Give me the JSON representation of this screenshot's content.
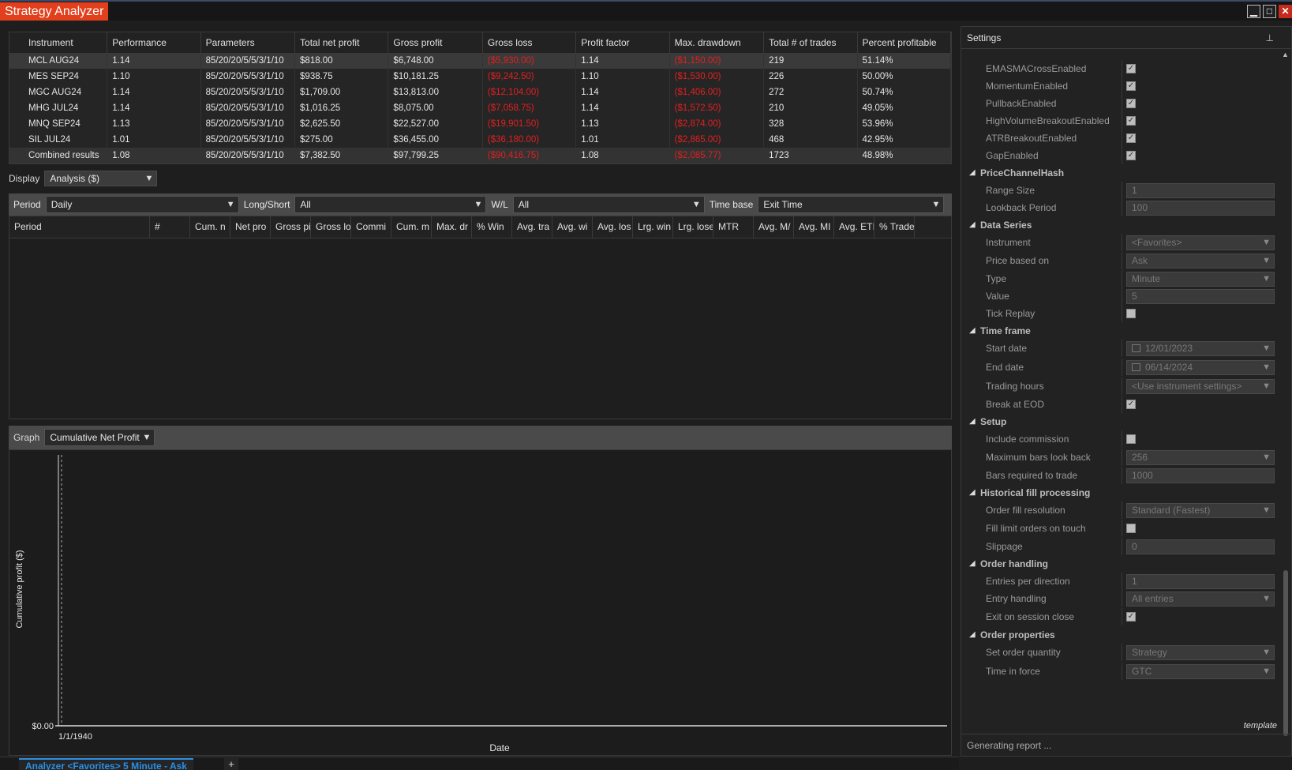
{
  "window": {
    "title": "Strategy Analyzer",
    "controls": {
      "minimize": "▁",
      "maximize": "□",
      "close": "✕"
    }
  },
  "results": {
    "columns": [
      "Instrument",
      "Performance",
      "Parameters",
      "Total net profit",
      "Gross profit",
      "Gross loss",
      "Profit factor",
      "Max. drawdown",
      "Total # of trades",
      "Percent profitable"
    ],
    "rows": [
      [
        "MCL AUG24",
        "1.14",
        "85/20/20/5/5/3/1/10",
        "$818.00",
        "$6,748.00",
        "($5,930.00)",
        "1.14",
        "($1,150.00)",
        "219",
        "51.14%"
      ],
      [
        "MES SEP24",
        "1.10",
        "85/20/20/5/5/3/1/10",
        "$938.75",
        "$10,181.25",
        "($9,242.50)",
        "1.10",
        "($1,530.00)",
        "226",
        "50.00%"
      ],
      [
        "MGC AUG24",
        "1.14",
        "85/20/20/5/5/3/1/10",
        "$1,709.00",
        "$13,813.00",
        "($12,104.00)",
        "1.14",
        "($1,406.00)",
        "272",
        "50.74%"
      ],
      [
        "MHG JUL24",
        "1.14",
        "85/20/20/5/5/3/1/10",
        "$1,016.25",
        "$8,075.00",
        "($7,058.75)",
        "1.14",
        "($1,572.50)",
        "210",
        "49.05%"
      ],
      [
        "MNQ SEP24",
        "1.13",
        "85/20/20/5/5/3/1/10",
        "$2,625.50",
        "$22,527.00",
        "($19,901.50)",
        "1.13",
        "($2,874.00)",
        "328",
        "53.96%"
      ],
      [
        "SIL JUL24",
        "1.01",
        "85/20/20/5/5/3/1/10",
        "$275.00",
        "$36,455.00",
        "($36,180.00)",
        "1.01",
        "($2,865.00)",
        "468",
        "42.95%"
      ],
      [
        "Combined results",
        "1.08",
        "85/20/20/5/5/3/1/10",
        "$7,382.50",
        "$97,799.25",
        "($90,416.75)",
        "1.08",
        "($2,085.77)",
        "1723",
        "48.98%"
      ]
    ]
  },
  "display": {
    "label": "Display",
    "value": "Analysis ($)"
  },
  "filters": {
    "period_label": "Period",
    "period_value": "Daily",
    "longshort_label": "Long/Short",
    "longshort_value": "All",
    "wl_label": "W/L",
    "wl_value": "All",
    "timebase_label": "Time base",
    "timebase_value": "Exit Time"
  },
  "period_columns": [
    "Period",
    "#",
    "Cum. n",
    "Net pro",
    "Gross pi",
    "Gross lo",
    "Commi",
    "Cum. m",
    "Max. dr",
    "% Win",
    "Avg. tra",
    "Avg. wi",
    "Avg. los",
    "Lrg. win",
    "Lrg. lose",
    "MTR",
    "Avg. M/",
    "Avg. MI",
    "Avg. ETI",
    "% Trade"
  ],
  "graph": {
    "label": "Graph",
    "value": "Cumulative Net Profit",
    "y_axis_label": "Cumulative profit ($)",
    "x_axis_label": "Date",
    "y_tick": "$0.00",
    "x_tick": "1/1/1940"
  },
  "bottom_tab": {
    "label": "Analyzer <Favorites> 5 Minute - Ask",
    "add": "+"
  },
  "settings": {
    "title": "Settings",
    "template_label": "template",
    "status": "Generating report ...",
    "items": [
      {
        "kind": "prop",
        "name": "EMASMACrossEnabled",
        "ctl": "check",
        "checked": true
      },
      {
        "kind": "prop",
        "name": "MomentumEnabled",
        "ctl": "check",
        "checked": true
      },
      {
        "kind": "prop",
        "name": "PullbackEnabled",
        "ctl": "check",
        "checked": true
      },
      {
        "kind": "prop",
        "name": "HighVolumeBreakoutEnabled",
        "ctl": "check",
        "checked": true
      },
      {
        "kind": "prop",
        "name": "ATRBreakoutEnabled",
        "ctl": "check",
        "checked": true
      },
      {
        "kind": "prop",
        "name": "GapEnabled",
        "ctl": "check",
        "checked": true
      },
      {
        "kind": "cat",
        "name": "PriceChannelHash"
      },
      {
        "kind": "prop",
        "name": "Range Size",
        "ctl": "text",
        "value": "1"
      },
      {
        "kind": "prop",
        "name": "Lookback Period",
        "ctl": "text",
        "value": "100"
      },
      {
        "kind": "cat",
        "name": "Data Series"
      },
      {
        "kind": "prop",
        "name": "Instrument",
        "ctl": "select",
        "value": "<Favorites>"
      },
      {
        "kind": "prop",
        "name": "Price based on",
        "ctl": "select",
        "value": "Ask"
      },
      {
        "kind": "prop",
        "name": "Type",
        "ctl": "select",
        "value": "Minute"
      },
      {
        "kind": "prop",
        "name": "Value",
        "ctl": "text",
        "value": "5"
      },
      {
        "kind": "prop",
        "name": "Tick Replay",
        "ctl": "check",
        "checked": false
      },
      {
        "kind": "cat",
        "name": "Time frame"
      },
      {
        "kind": "prop",
        "name": "Start date",
        "ctl": "date",
        "value": "12/01/2023"
      },
      {
        "kind": "prop",
        "name": "End date",
        "ctl": "date",
        "value": "06/14/2024"
      },
      {
        "kind": "prop",
        "name": "Trading hours",
        "ctl": "select",
        "value": "<Use instrument settings>"
      },
      {
        "kind": "prop",
        "name": "Break at EOD",
        "ctl": "check",
        "checked": true
      },
      {
        "kind": "cat",
        "name": "Setup"
      },
      {
        "kind": "prop",
        "name": "Include commission",
        "ctl": "check",
        "checked": false
      },
      {
        "kind": "prop",
        "name": "Maximum bars look back",
        "ctl": "select",
        "value": "256"
      },
      {
        "kind": "prop",
        "name": "Bars required to trade",
        "ctl": "text",
        "value": "1000"
      },
      {
        "kind": "cat",
        "name": "Historical fill processing"
      },
      {
        "kind": "prop",
        "name": "Order fill resolution",
        "ctl": "select",
        "value": "Standard (Fastest)"
      },
      {
        "kind": "prop",
        "name": "Fill limit orders on touch",
        "ctl": "check",
        "checked": false
      },
      {
        "kind": "prop",
        "name": "Slippage",
        "ctl": "text",
        "value": "0"
      },
      {
        "kind": "cat",
        "name": "Order handling"
      },
      {
        "kind": "prop",
        "name": "Entries per direction",
        "ctl": "text",
        "value": "1"
      },
      {
        "kind": "prop",
        "name": "Entry handling",
        "ctl": "select",
        "value": "All entries"
      },
      {
        "kind": "prop",
        "name": "Exit on session close",
        "ctl": "check",
        "checked": true
      },
      {
        "kind": "cat",
        "name": "Order properties"
      },
      {
        "kind": "prop",
        "name": "Set order quantity",
        "ctl": "select",
        "value": "Strategy"
      },
      {
        "kind": "prop",
        "name": "Time in force",
        "ctl": "select",
        "value": "GTC"
      }
    ]
  },
  "colors": {
    "accent": "#e2401c",
    "negative": "#e02020",
    "link": "#2b8fe6"
  }
}
